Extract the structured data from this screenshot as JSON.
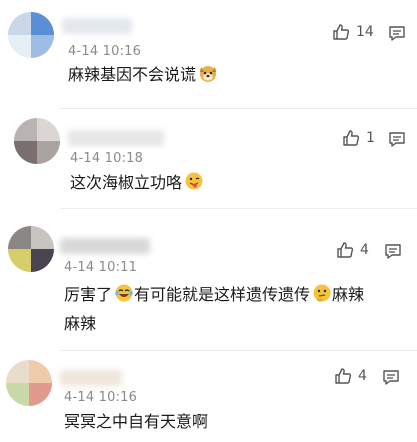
{
  "comments": [
    {
      "time": "4-14 10:16",
      "text": "麻辣基因不会说谎",
      "likes": "14",
      "emoji": "dog-face-emoji"
    },
    {
      "time": "4-14 10:18",
      "text": "这次海椒立功咯",
      "likes": "1",
      "emoji": "tongue-out-emoji"
    },
    {
      "time": "4-14 10:11",
      "text_a": "厉害了",
      "text_b": "有可能就是这样遗传遗传",
      "text_c": "麻辣",
      "text_d": "麻辣",
      "likes": "4",
      "emoji_a": "laughing-tears-emoji",
      "emoji_b": "thinking-emoji"
    },
    {
      "time": "4-14 10:16",
      "text": "冥冥之中自有天意啊",
      "likes": "4"
    }
  ],
  "colors": {
    "text": "#1a1a1a",
    "meta": "#8a8a8a",
    "divider": "#ececec",
    "icon": "#555555"
  }
}
